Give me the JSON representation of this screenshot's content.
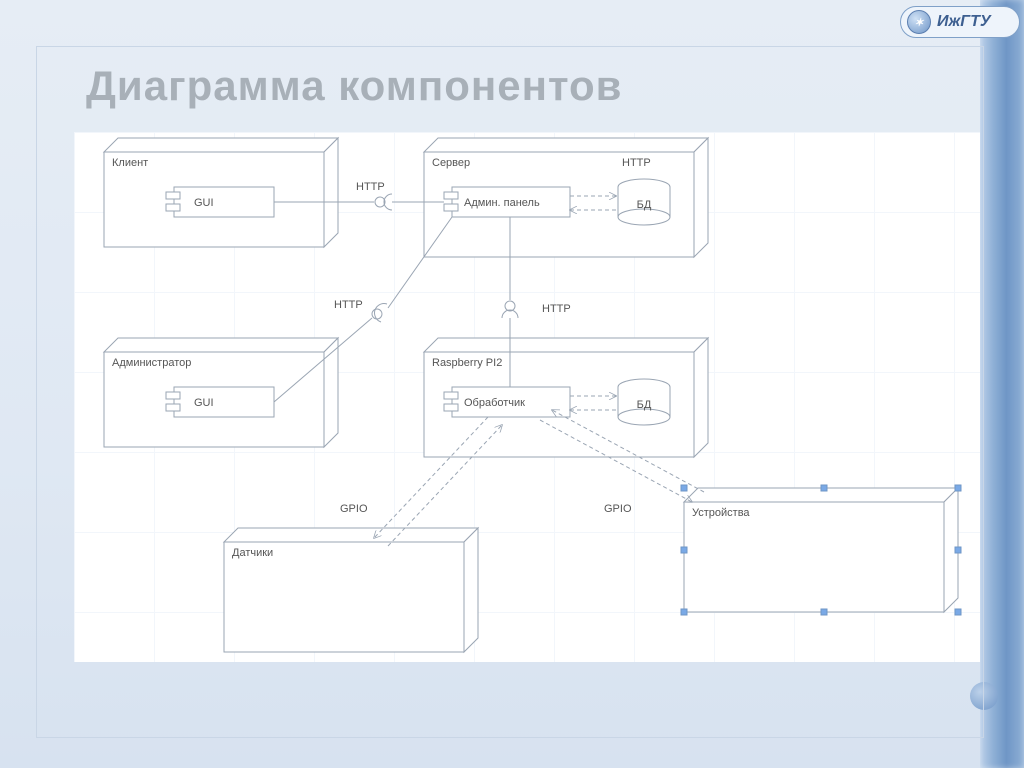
{
  "slide": {
    "title": "Диаграмма компонентов"
  },
  "brand": {
    "text": "ИжГТУ"
  },
  "nodes": {
    "client": {
      "title": "Клиент",
      "component": "GUI"
    },
    "admin": {
      "title": "Администратор",
      "component": "GUI"
    },
    "server": {
      "title": "Сервер",
      "component": "Админ. панель",
      "db": "БД"
    },
    "rpi": {
      "title": "Raspberry PI2",
      "component": "Обработчик",
      "db": "БД"
    },
    "sensors": {
      "title": "Датчики"
    },
    "devices": {
      "title": "Устройства"
    }
  },
  "edges": {
    "client_server": {
      "label": "HTTP"
    },
    "admin_server": {
      "label": "HTTP"
    },
    "server_db": {
      "label": "HTTP"
    },
    "server_rpi": {
      "label": "HTTP"
    },
    "rpi_sensors": {
      "label": "GPIO"
    },
    "rpi_devices": {
      "label": "GPIO"
    }
  }
}
